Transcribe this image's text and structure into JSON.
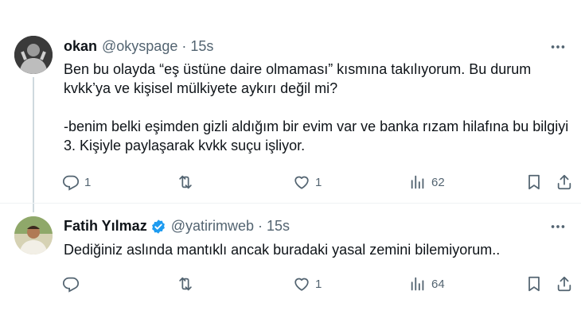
{
  "tweets": [
    {
      "author_name": "okan",
      "handle": "@okyspage",
      "separator": "·",
      "time": "15s",
      "verified": false,
      "paragraphs": [
        "Ben bu olayda “eş üstüne daire olmaması” kısmına takılıyorum. Bu durum kvkk’ya ve kişisel mülkiyete aykırı değil mi?",
        "-benim belki eşimden gizli aldığım bir evim var ve banka rızam hilafına bu bilgiyi 3. Kişiyle paylaşarak kvkk suçu işliyor."
      ],
      "reply_count": "1",
      "retweet_count": "",
      "like_count": "1",
      "view_count": "62"
    },
    {
      "author_name": "Fatih Yılmaz",
      "handle": "@yatirimweb",
      "separator": "·",
      "time": "15s",
      "verified": true,
      "paragraphs": [
        "Dediğiniz aslında mantıklı ancak buradaki yasal zemini bilemiyorum.."
      ],
      "reply_count": "",
      "retweet_count": "",
      "like_count": "1",
      "view_count": "64"
    }
  ],
  "colors": {
    "text_primary": "#0f1419",
    "text_secondary": "#536471",
    "verified_badge": "#1d9bf0",
    "divider": "#eff3f4",
    "thread_line": "#cfd9de"
  },
  "icons": {
    "reply": "reply-icon",
    "retweet": "retweet-icon",
    "like": "heart-icon",
    "views": "views-chart-icon",
    "bookmark": "bookmark-icon",
    "share": "share-icon",
    "more": "more-dots-icon",
    "verified": "verified-badge-icon"
  }
}
